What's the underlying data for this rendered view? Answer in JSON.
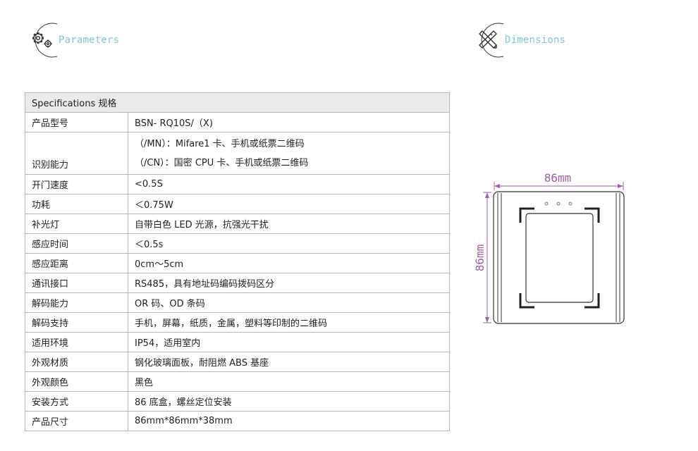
{
  "sections": {
    "parameters": {
      "title": "Parameters",
      "icon": "gears-icon"
    },
    "dimensions": {
      "title": "Dimensions",
      "icon": "ruler-pencil-icon"
    }
  },
  "spec_table": {
    "header": "Specifications 规格",
    "rows": [
      {
        "label": "产品型号",
        "value": "BSN- RQ10S/（X)"
      },
      {
        "label": "识别能力",
        "values": [
          "（/MN）：Mifare1 卡、手机或纸票二维码",
          "（/CN）：国密 CPU 卡、手机或纸票二维码"
        ]
      },
      {
        "label": "开门速度",
        "value": "<0.5S"
      },
      {
        "label": "功耗",
        "value": "＜0.75W"
      },
      {
        "label": "补光灯",
        "value": "自带白色 LED 光源，抗强光干扰"
      },
      {
        "label": "感应时间",
        "value": "＜0.5s"
      },
      {
        "label": "感应距离",
        "value": "0cm～5cm"
      },
      {
        "label": "通讯接口",
        "value": "RS485，具有地址码编码拨码区分"
      },
      {
        "label": "解码能力",
        "value": "OR 码、OD 条码"
      },
      {
        "label": "解码支持",
        "value": "手机，屏幕，纸质，金属，塑料等印制的二维码"
      },
      {
        "label": "适用环境",
        "value": "IP54，适用室内"
      },
      {
        "label": "外观材质",
        "value": "钢化玻璃面板，耐阻燃 ABS 基座"
      },
      {
        "label": "外观颜色",
        "value": "黑色"
      },
      {
        "label": "安装方式",
        "value": "86 底盒，螺丝定位安装"
      },
      {
        "label": "产品尺寸",
        "value": "86mm*86mm*38mm"
      }
    ]
  },
  "dimension_drawing": {
    "width_label": "86mm",
    "height_label": "86mm",
    "accent_color": "#a05fa8",
    "line_color": "#333333"
  }
}
